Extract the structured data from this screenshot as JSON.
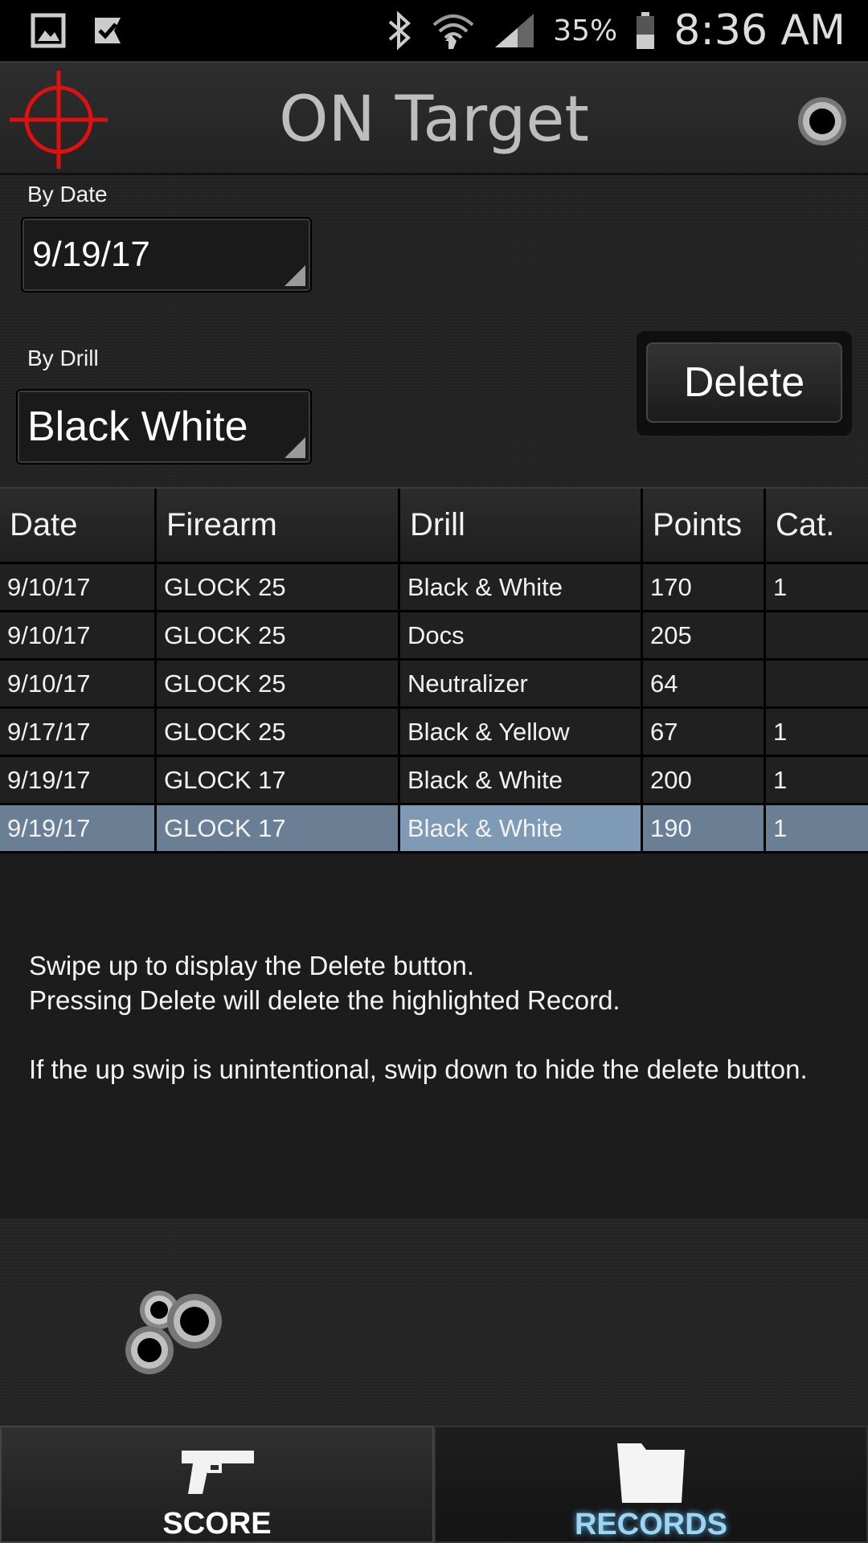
{
  "status_bar": {
    "battery_percent": "35%",
    "time": "8:36 AM",
    "left_icons": [
      "gallery-icon",
      "task-check-icon"
    ],
    "right_icons": [
      "bluetooth-icon",
      "wifi-icon",
      "signal-icon",
      "battery-icon"
    ]
  },
  "app_bar": {
    "title": "ON Target",
    "logo_icon": "crosshair-icon",
    "action_icon": "bullet-hole-icon"
  },
  "filters": {
    "date_label": "By Date",
    "date_value": "9/19/17",
    "drill_label": "By Drill",
    "drill_value": "Black  White",
    "delete_label": "Delete"
  },
  "table": {
    "headers": [
      "Date",
      "Firearm",
      "Drill",
      "Points",
      "Cat."
    ],
    "rows": [
      [
        "9/10/17",
        "GLOCK 25",
        "Black & White",
        "170",
        "1"
      ],
      [
        "9/10/17",
        "GLOCK 25",
        "Docs",
        "205",
        ""
      ],
      [
        "9/10/17",
        "GLOCK 25",
        "Neutralizer",
        "64",
        ""
      ],
      [
        "9/17/17",
        "GLOCK 25",
        "Black & Yellow",
        "67",
        "1"
      ],
      [
        "9/19/17",
        "GLOCK 17",
        "Black & White",
        "200",
        "1"
      ],
      [
        "9/19/17",
        "GLOCK 17",
        "Black & White",
        "190",
        "1"
      ]
    ],
    "selected_row_index": 5
  },
  "help": {
    "line1": "Swipe up to display the Delete button.",
    "line2": "Pressing Delete will delete the highlighted Record.",
    "line3": "If the up swip is unintentional, swip down to hide the delete button."
  },
  "bottom_nav": {
    "score_label": "SCORE",
    "records_label": "RECORDS",
    "active": "records"
  },
  "colors": {
    "selected_row": "#6a7f93",
    "selected_cell": "#7f9ab4",
    "crosshair": "#e01010",
    "records_label": "#9fd4f0"
  }
}
